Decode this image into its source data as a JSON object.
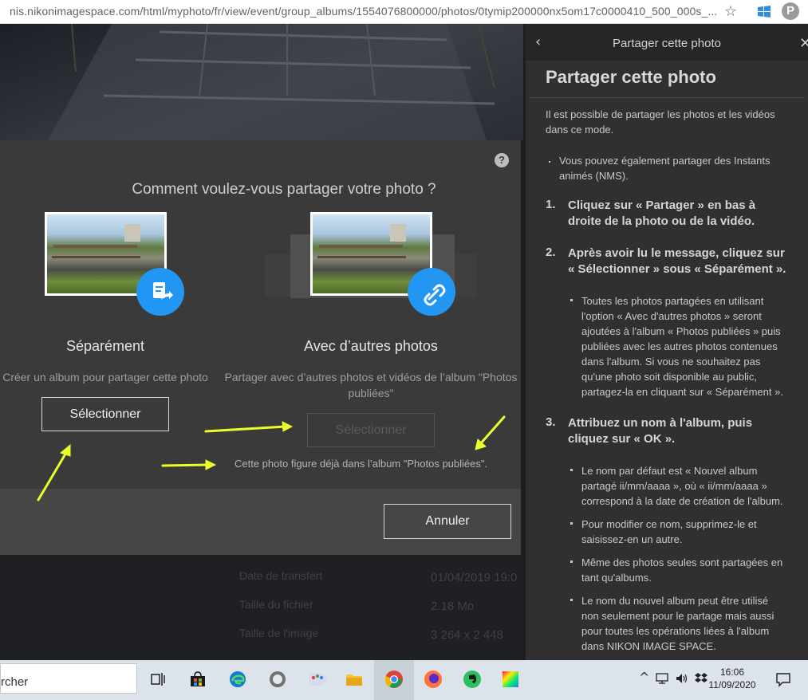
{
  "browser": {
    "url": "nis.nikonimagespace.com/html/myphoto/fr/view/event/group_albums/1554076800000/photos/0tymip200000nx5om17c0000410_500_000s_...",
    "bookmark_icon": "star-icon",
    "extension_icon": "windows-extension-icon",
    "pinterest_icon": "pinterest-icon"
  },
  "background": {
    "details": [
      {
        "label": "Date de transfert",
        "value": "01/04/2019 19:0"
      },
      {
        "label": "Taille du fichier",
        "value": "2.18 Mo"
      },
      {
        "label": "Taille de l'image",
        "value": "3 264 x 2 448"
      }
    ]
  },
  "dialog": {
    "help_icon": "?",
    "title": "Comment voulez-vous partager votre photo ?",
    "option_separate": {
      "title": "Séparément",
      "description": "Créer un album pour partager cette photo",
      "button": "Sélectionner",
      "badge_icon": "share-document-icon"
    },
    "option_with_others": {
      "title": "Avec d’autres photos",
      "description": "Partager avec d’autres photos et vidéos de l’album \"Photos publiées\"",
      "button": "Sélectionner",
      "badge_icon": "link-icon"
    },
    "note": "Cette photo figure déjà dans l’album \"Photos publiées\".",
    "cancel": "Annuler",
    "annotation_color": "#eaff2a"
  },
  "panel": {
    "header_title": "Partager cette photo",
    "back_icon": "chevron-left-icon",
    "close_icon": "close-icon",
    "title": "Partager cette photo",
    "intro_line1": "Il est possible de partager les photos et les vidéos",
    "intro_line2": "dans ce mode.",
    "note_line1": "Vous pouvez également partager des Instants",
    "note_line2": "animés (NMS).",
    "step1": {
      "num": "1.",
      "line1": "Cliquez sur « Partager » en bas à",
      "line2": "droite de la photo ou de la vidéo."
    },
    "step2": {
      "num": "2.",
      "line1": "Après avoir lu le message, cliquez sur",
      "line2": "« Sélectionner » sous « Séparément »."
    },
    "step2_bullet": [
      "Toutes les photos partagées en utilisant",
      "l'option « Avec d'autres photos » seront",
      "ajoutées à l'album « Photos publiées » puis",
      "publiées avec les autres photos contenues",
      "dans l'album. Si vous ne souhaitez pas",
      "qu'une photo soit disponible au public,",
      "partagez-la en cliquant sur « Séparément »."
    ],
    "step3": {
      "num": "3.",
      "line1": "Attribuez un nom à l'album, puis",
      "line2": "cliquez sur « OK »."
    },
    "step3_bullet1": [
      "Le nom par défaut est « Nouvel album",
      "partagé ii/mm/aaaa », où « ii/mm/aaaa »",
      "correspond à la date de création de l'album."
    ],
    "step3_bullet2": [
      "Pour modifier ce nom, supprimez-le et",
      "saisissez-en un autre."
    ],
    "step3_bullet3": [
      "Même des photos seules sont partagées en",
      "tant qu'albums."
    ],
    "step3_bullet4": [
      "Le nom du nouvel album peut être utilisé",
      "non seulement pour le partage mais aussi",
      "pour toutes les opérations liées à l'album",
      "dans NIKON IMAGE SPACE."
    ]
  },
  "taskbar": {
    "search_text": "rcher",
    "icons": [
      "task-view-icon",
      "store-icon",
      "edge-icon",
      "app-icon",
      "paint-icon",
      "file-explorer-icon",
      "chrome-icon",
      "firefox-icon",
      "evernote-icon",
      "color-app-icon"
    ],
    "tray_chevron": "^",
    "time": "16:06",
    "date": "11/09/2020"
  }
}
